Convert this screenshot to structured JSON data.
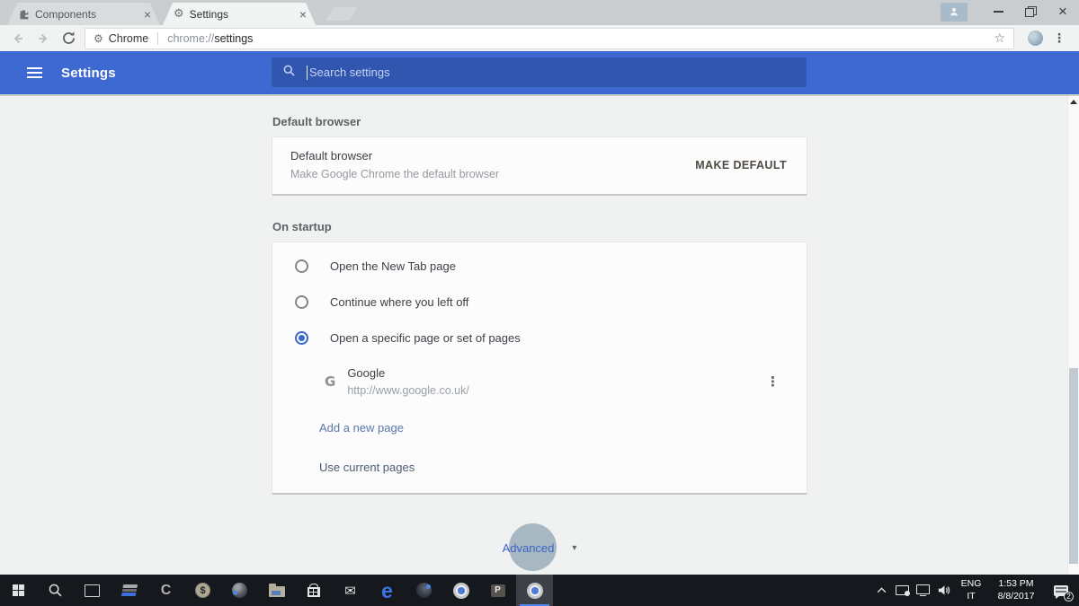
{
  "window": {
    "tabs": [
      {
        "title": "Components"
      },
      {
        "title": "Settings"
      }
    ]
  },
  "toolbar": {
    "chip_label": "Chrome",
    "url_scheme": "chrome://",
    "url_rest": "settings"
  },
  "header": {
    "title": "Settings",
    "search_placeholder": "Search settings"
  },
  "page": {
    "default_browser": {
      "heading": "Default browser",
      "title": "Default browser",
      "subtitle": "Make Google Chrome the default browser",
      "button": "MAKE DEFAULT"
    },
    "on_startup": {
      "heading": "On startup",
      "options": [
        {
          "label": "Open the New Tab page",
          "selected": false
        },
        {
          "label": "Continue where you left off",
          "selected": false
        },
        {
          "label": "Open a specific page or set of pages",
          "selected": true
        }
      ],
      "site": {
        "name": "Google",
        "url": "http://www.google.co.uk/"
      },
      "add_link": "Add a new page",
      "use_link": "Use current pages"
    },
    "advanced_label": "Advanced"
  },
  "taskbar": {
    "tray": {
      "lang_primary": "ENG",
      "lang_secondary": "IT",
      "time": "1:53 PM",
      "date": "8/8/2017",
      "notification_count": "2"
    }
  },
  "icons": {
    "gear": "⚙",
    "star": "☆",
    "menu_dots": "⋮",
    "mail": "✉",
    "google_g": "G",
    "c_app": "C",
    "dollar": "$",
    "ppt": "P",
    "edge": "e",
    "caret_down": "▾",
    "close": "×"
  },
  "colors": {
    "header_blue": "#3e69d2",
    "search_field_blue": "#3156b0",
    "selected_radio_blue": "#3a67cc",
    "advanced_text_blue": "#3d62c4",
    "link_blue": "#5a78ad",
    "taskbar_bg": "#15181d",
    "active_underline": "#4a86e8"
  }
}
